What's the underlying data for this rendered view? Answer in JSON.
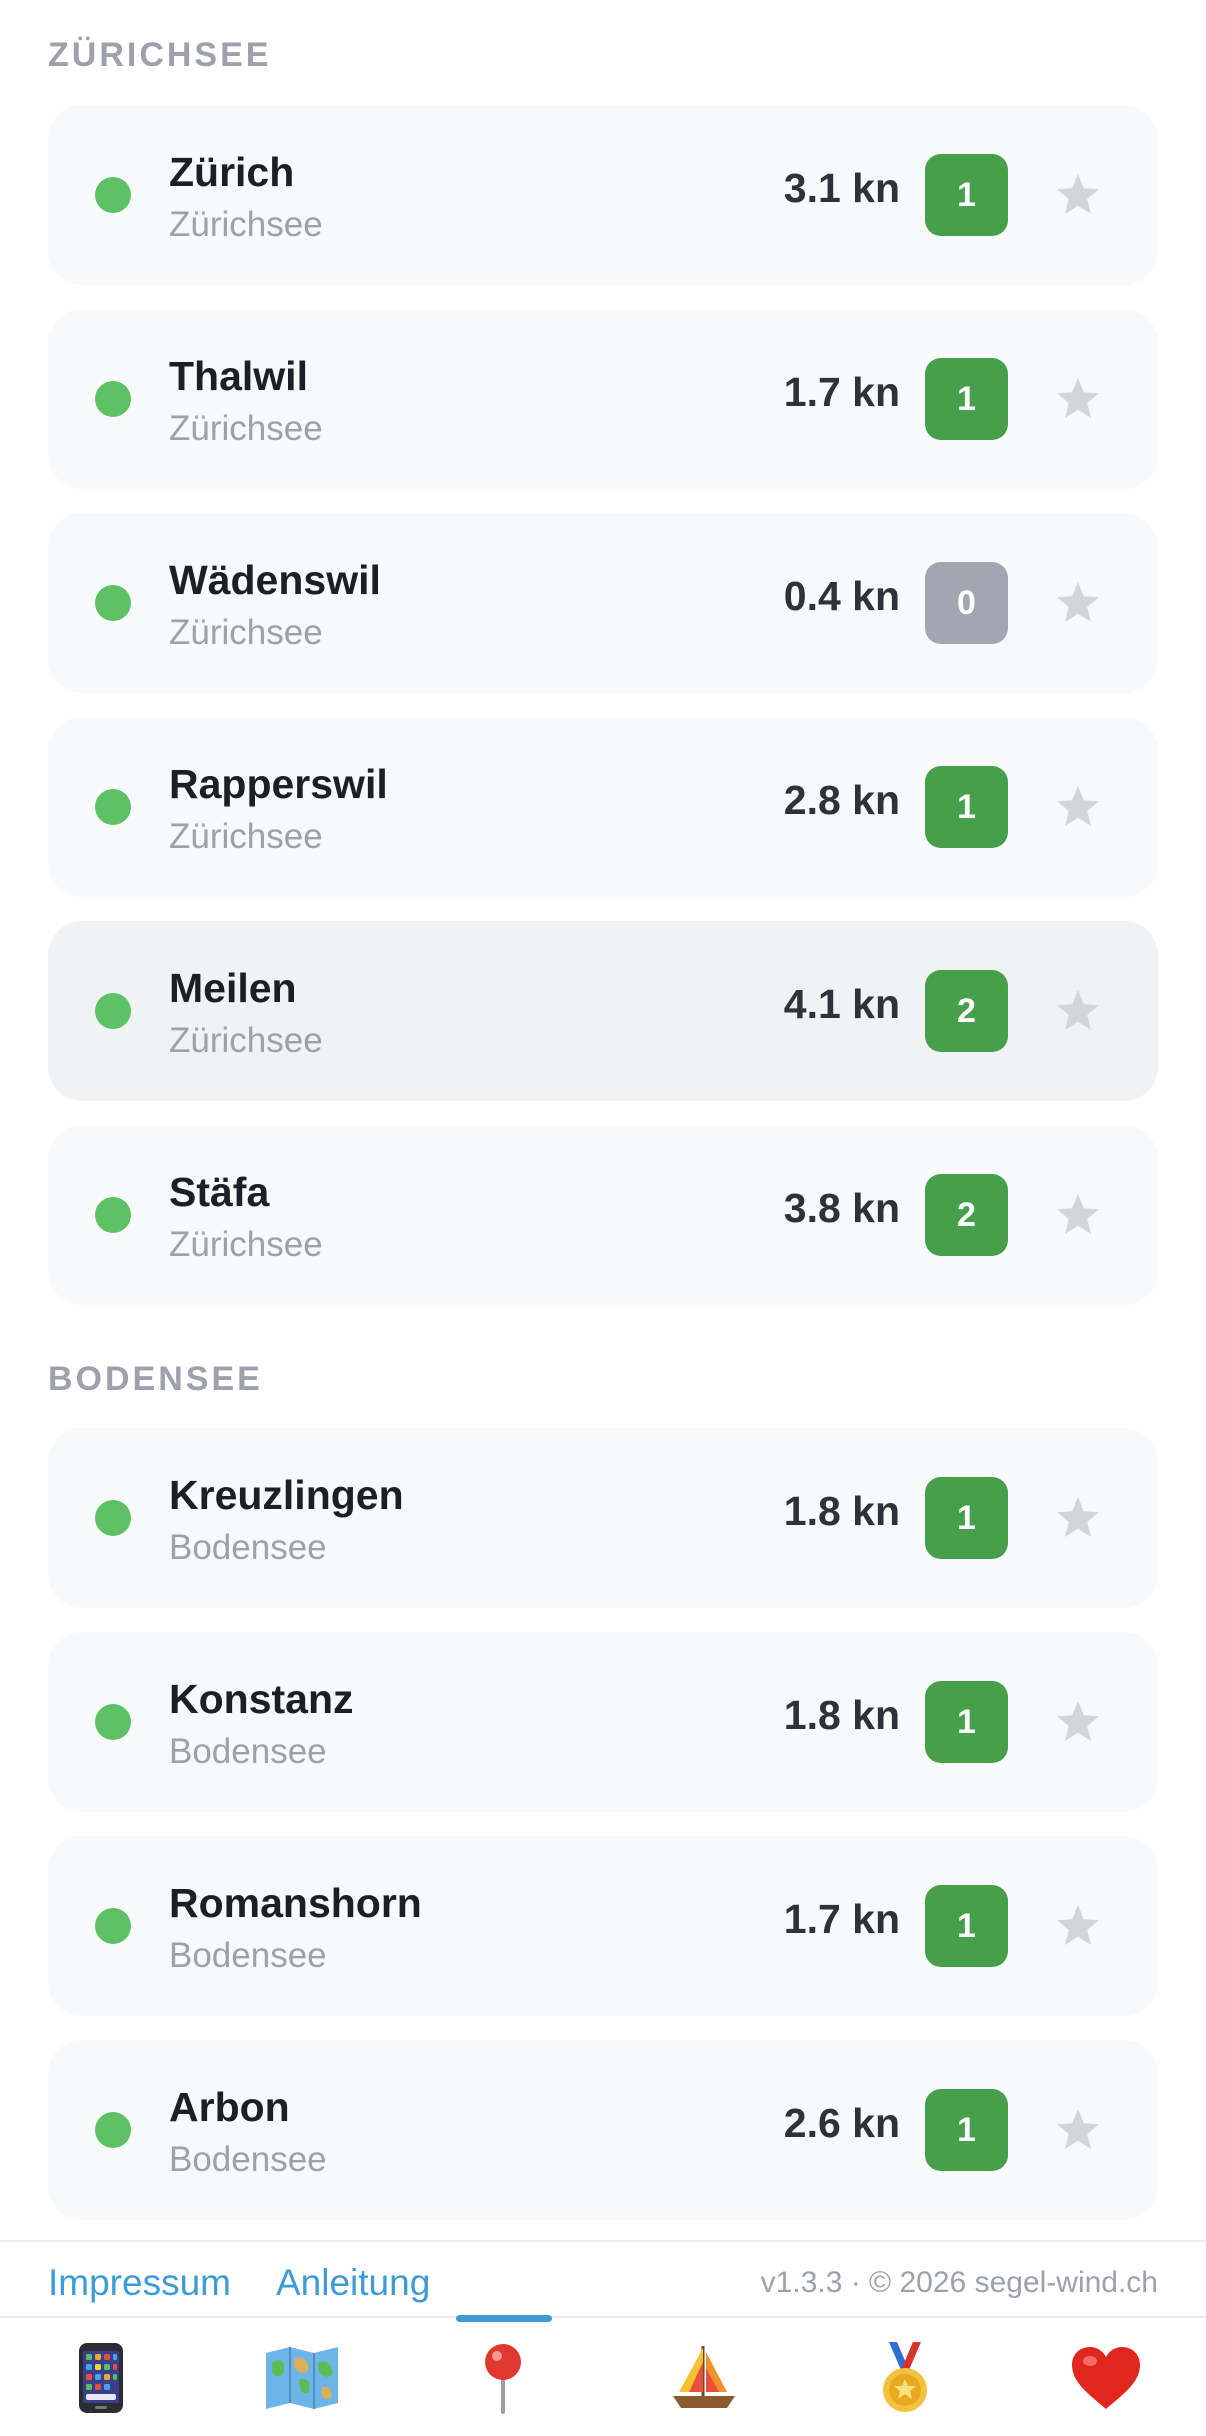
{
  "sections": [
    {
      "title": "ZÜRICHSEE",
      "stations": [
        {
          "name": "Zürich",
          "lake": "Zürichsee",
          "speed": "3.1 kn",
          "level": "1",
          "badge_color": "#46a04b"
        },
        {
          "name": "Thalwil",
          "lake": "Zürichsee",
          "speed": "1.7 kn",
          "level": "1",
          "badge_color": "#46a04b"
        },
        {
          "name": "Wädenswil",
          "lake": "Zürichsee",
          "speed": "0.4 kn",
          "level": "0",
          "badge_color": "#a2a6b0"
        },
        {
          "name": "Rapperswil",
          "lake": "Zürichsee",
          "speed": "2.8 kn",
          "level": "1",
          "badge_color": "#46a04b"
        },
        {
          "name": "Meilen",
          "lake": "Zürichsee",
          "speed": "4.1 kn",
          "level": "2",
          "badge_color": "#46a04b",
          "highlighted": true
        },
        {
          "name": "Stäfa",
          "lake": "Zürichsee",
          "speed": "3.8 kn",
          "level": "2",
          "badge_color": "#46a04b"
        }
      ]
    },
    {
      "title": "BODENSEE",
      "stations": [
        {
          "name": "Kreuzlingen",
          "lake": "Bodensee",
          "speed": "1.8 kn",
          "level": "1",
          "badge_color": "#46a04b"
        },
        {
          "name": "Konstanz",
          "lake": "Bodensee",
          "speed": "1.8 kn",
          "level": "1",
          "badge_color": "#46a04b"
        },
        {
          "name": "Romanshorn",
          "lake": "Bodensee",
          "speed": "1.7 kn",
          "level": "1",
          "badge_color": "#46a04b"
        },
        {
          "name": "Arbon",
          "lake": "Bodensee",
          "speed": "2.6 kn",
          "level": "1",
          "badge_color": "#46a04b"
        }
      ]
    }
  ],
  "status_dot_color": "#5cc264",
  "favorite_icon": "star-icon",
  "footer": {
    "impressum": "Impressum",
    "anleitung": "Anleitung",
    "version": "v1.3.3 · © 2026 segel-wind.ch"
  },
  "tabs": [
    {
      "icon": "phone-icon",
      "active": false
    },
    {
      "icon": "map-icon",
      "active": false
    },
    {
      "icon": "pin-icon",
      "active": true
    },
    {
      "icon": "sailboat-icon",
      "active": false
    },
    {
      "icon": "medal-icon",
      "active": false
    },
    {
      "icon": "heart-icon",
      "active": false
    }
  ],
  "accent_color": "#3d9bd6"
}
